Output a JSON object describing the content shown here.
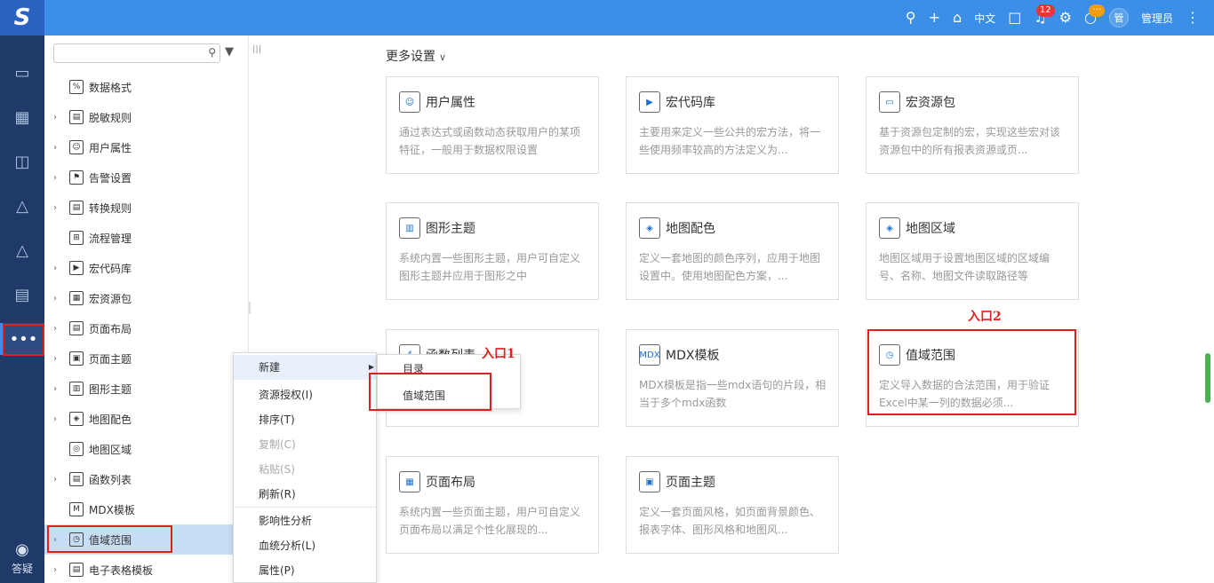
{
  "topbar": {
    "logo": "S",
    "lang": "中文",
    "notif_count": "12",
    "chat_badge": "···",
    "avatar": "管",
    "username": "管理员"
  },
  "rail": {
    "help_label": "答疑"
  },
  "tree": {
    "search_placeholder": "",
    "nodes": [
      {
        "label": "数据格式",
        "arrow": ""
      },
      {
        "label": "脱敏规则",
        "arrow": "›"
      },
      {
        "label": "用户属性",
        "arrow": "›"
      },
      {
        "label": "告警设置",
        "arrow": "›"
      },
      {
        "label": "转换规则",
        "arrow": "›"
      },
      {
        "label": "流程管理",
        "arrow": ""
      },
      {
        "label": "宏代码库",
        "arrow": "›"
      },
      {
        "label": "宏资源包",
        "arrow": "›"
      },
      {
        "label": "页面布局",
        "arrow": "›"
      },
      {
        "label": "页面主题",
        "arrow": "›"
      },
      {
        "label": "图形主题",
        "arrow": "›"
      },
      {
        "label": "地图配色",
        "arrow": "›"
      },
      {
        "label": "地图区域",
        "arrow": ""
      },
      {
        "label": "函数列表",
        "arrow": "›"
      },
      {
        "label": "MDX模板",
        "arrow": ""
      },
      {
        "label": "值域范围",
        "arrow": "›"
      },
      {
        "label": "电子表格模板",
        "arrow": "›"
      }
    ]
  },
  "main": {
    "more_settings": "更多设置",
    "cards": [
      {
        "title": "用户属性",
        "desc": "通过表达式或函数动态获取用户的某项特征，一般用于数据权限设置"
      },
      {
        "title": "宏代码库",
        "desc": "主要用来定义一些公共的宏方法，将一些使用频率较高的方法定义为..."
      },
      {
        "title": "宏资源包",
        "desc": "基于资源包定制的宏，实现这些宏对该资源包中的所有报表资源或页..."
      },
      {
        "title": "图形主题",
        "desc": "系统内置一些图形主题，用户可自定义图形主题并应用于图形之中"
      },
      {
        "title": "地图配色",
        "desc": "定义一套地图的颜色序列，应用于地图设置中。使用地图配色方案，..."
      },
      {
        "title": "地图区域",
        "desc": "地图区域用于设置地图区域的区域编号、名称、地图文件读取路径等"
      },
      {
        "title": "函数列表",
        "desc": "...DX函数"
      },
      {
        "title": "MDX模板",
        "desc": "MDX模板是指一些mdx语句的片段，相当于多个mdx函数"
      },
      {
        "title": "值域范围",
        "desc": "定义导入数据的合法范围，用于验证Excel中某一列的数据必须..."
      },
      {
        "title": "页面布局",
        "desc": "系统内置一些页面主题，用户可自定义页面布局以满足个性化展现的..."
      },
      {
        "title": "页面主题",
        "desc": "定义一套页面风格，如页面背景颜色、报表字体、图形风格和地图风..."
      }
    ]
  },
  "context_menu": {
    "items": [
      "新建",
      "资源授权(I)",
      "排序(T)",
      "复制(C)",
      "粘贴(S)",
      "刷新(R)",
      "影响性分析",
      "血统分析(L)",
      "属性(P)"
    ]
  },
  "submenu": {
    "items": [
      "目录",
      "值域范围"
    ]
  },
  "annotations": {
    "entry1": "入口1",
    "entry2": "入口2"
  },
  "colors": {
    "topbar": "#3c8fe6",
    "rail": "#1f3a68",
    "annotation": "#e02020"
  }
}
